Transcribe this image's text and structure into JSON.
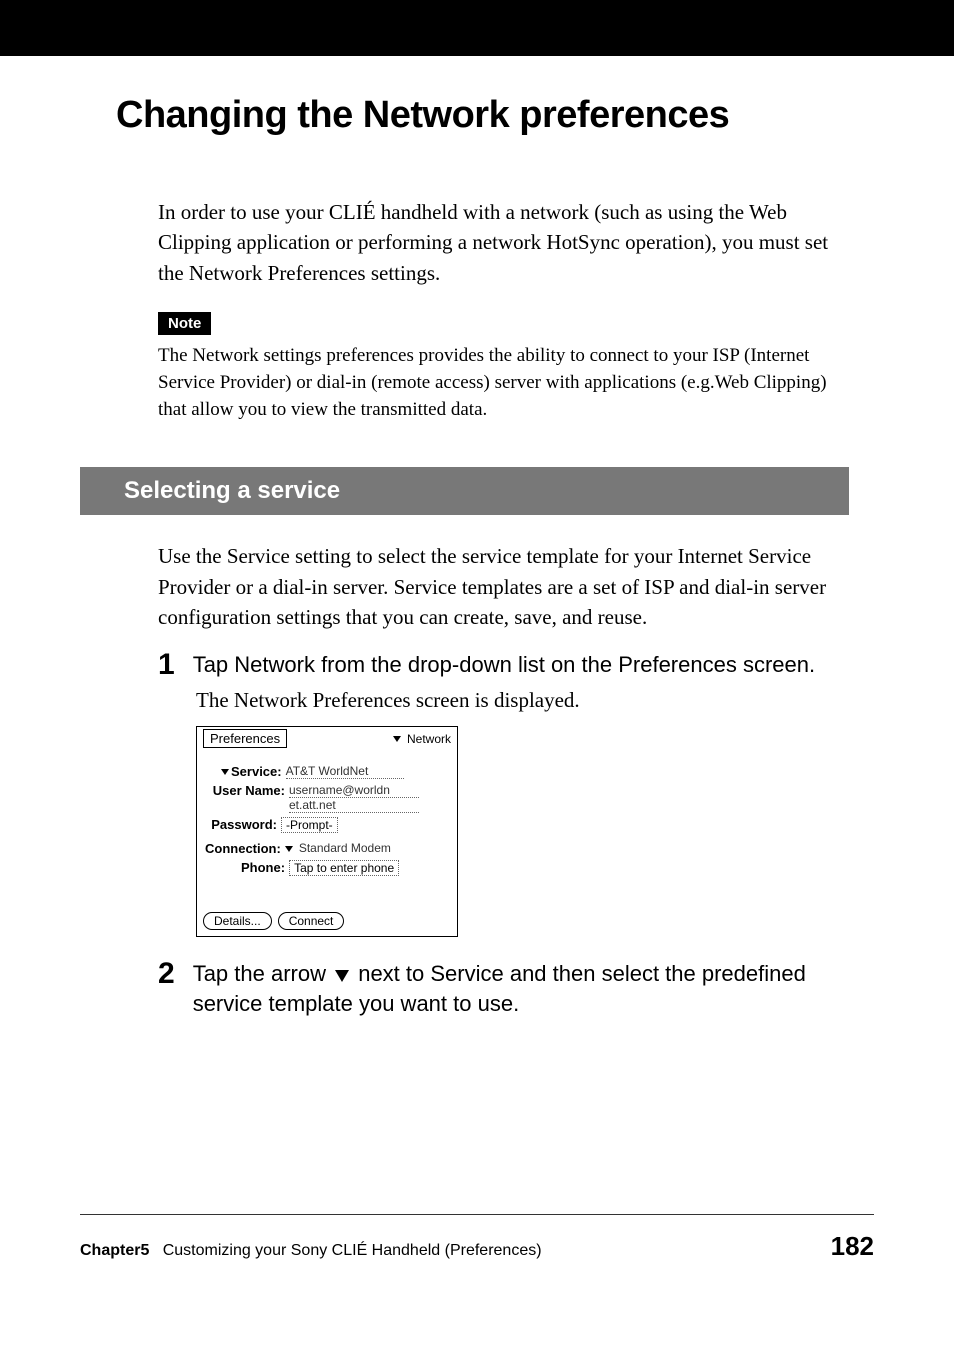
{
  "pageTitle": "Changing the Network preferences",
  "introText": "In order to use your CLIÉ handheld with a network (such as using the Web Clipping application or performing a network HotSync operation), you must set the Network Preferences settings.",
  "noteBadge": "Note",
  "noteText": "The Network settings preferences provides the ability to connect to your ISP (Internet Service Provider) or dial-in (remote access) server with applications (e.g.Web Clipping) that allow you to view the transmitted data.",
  "sectionHeader": "Selecting a service",
  "sectionIntro": "Use the Service setting to select the service template for your Internet Service Provider or a dial-in server. Service templates are a set of ISP and dial-in server configuration settings that you can create, save, and reuse.",
  "step1": {
    "number": "1",
    "text": "Tap Network from the drop-down list on the Preferences screen.",
    "subtext": "The Network Preferences screen is displayed."
  },
  "palm": {
    "title": "Preferences",
    "headerDropdown": "Network",
    "serviceLabel": "Service:",
    "serviceValue": "AT&T WorldNet",
    "usernameLabel": "User Name:",
    "usernameValue1": "username@worldn",
    "usernameValue2": "et.att.net",
    "passwordLabel": "Password:",
    "passwordValue": "-Prompt-",
    "connectionLabel": "Connection:",
    "connectionValue": "Standard Modem",
    "phoneLabel": "Phone:",
    "phoneValue": "Tap to enter phone",
    "detailsBtn": "Details...",
    "connectBtn": "Connect"
  },
  "step2": {
    "number": "2",
    "textBefore": "Tap the arrow ",
    "textAfter": " next to Service and then select the predefined service template you want to use."
  },
  "footer": {
    "chapter": "Chapter5",
    "chapterDesc": "Customizing your Sony CLIÉ Handheld (Preferences)",
    "pageNumber": "182"
  }
}
